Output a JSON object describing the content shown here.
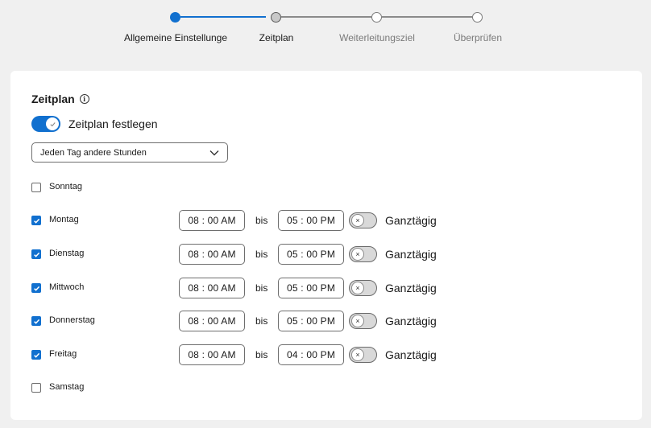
{
  "stepper": {
    "steps": [
      {
        "label": "Allgemeine Einstellunge",
        "state": "completed"
      },
      {
        "label": "Zeitplan",
        "state": "current"
      },
      {
        "label": "Weiterleitungsziel",
        "state": "future"
      },
      {
        "label": "Überprüfen",
        "state": "future"
      }
    ]
  },
  "section": {
    "title": "Zeitplan",
    "info_icon": "info-icon"
  },
  "schedule_toggle": {
    "label": "Zeitplan festlegen",
    "on": true
  },
  "mode_select": {
    "value": "Jeden Tag andere Stunden"
  },
  "days": [
    {
      "label": "Sonntag",
      "checked": false
    },
    {
      "label": "Montag",
      "checked": true,
      "from": "08 : 00 AM",
      "separator": "bis",
      "to": "05 : 00 PM",
      "allday_label": "Ganztägig",
      "allday": false
    },
    {
      "label": "Dienstag",
      "checked": true,
      "from": "08 : 00 AM",
      "separator": "bis",
      "to": "05 : 00 PM",
      "allday_label": "Ganztägig",
      "allday": false
    },
    {
      "label": "Mittwoch",
      "checked": true,
      "from": "08 : 00 AM",
      "separator": "bis",
      "to": "05 : 00 PM",
      "allday_label": "Ganztägig",
      "allday": false
    },
    {
      "label": "Donnerstag",
      "checked": true,
      "from": "08 : 00 AM",
      "separator": "bis",
      "to": "05 : 00 PM",
      "allday_label": "Ganztägig",
      "allday": false
    },
    {
      "label": "Freitag",
      "checked": true,
      "from": "08 : 00 AM",
      "separator": "bis",
      "to": "04 : 00 PM",
      "allday_label": "Ganztägig",
      "allday": false
    },
    {
      "label": "Samstag",
      "checked": false
    }
  ],
  "colors": {
    "accent": "#1170cf",
    "background": "#f0f0f0",
    "card": "#ffffff"
  }
}
